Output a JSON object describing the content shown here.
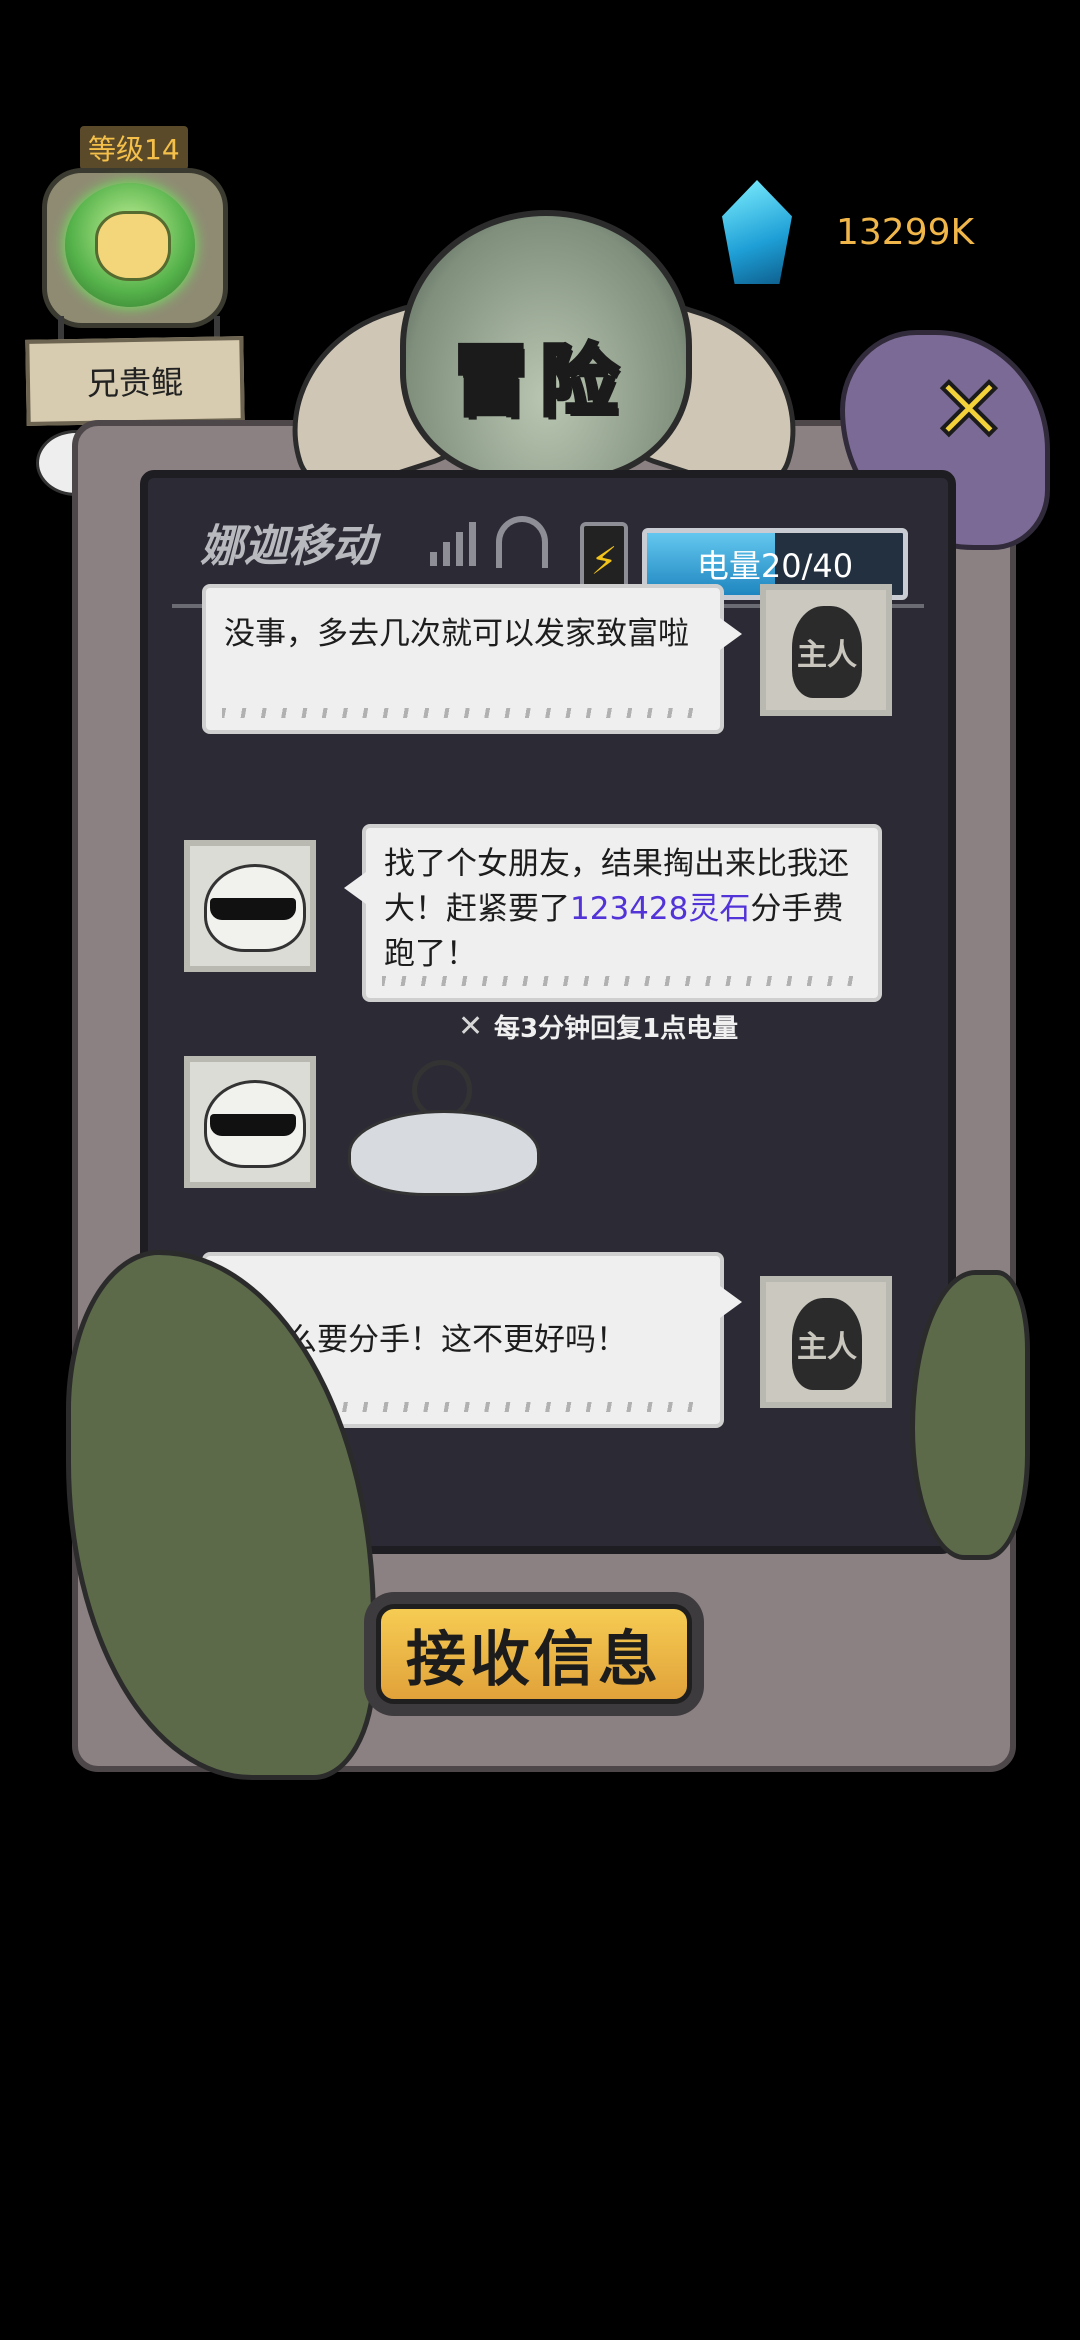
{
  "player": {
    "level": "等级14",
    "name": "兄贵鲲"
  },
  "alert": "!",
  "currency": {
    "icon": "spirit-stone-gem-icon",
    "value": "13299K",
    "color": "#f0b64a"
  },
  "title": "冒险",
  "close_label": "✕",
  "phone": {
    "carrier": "娜迦移动",
    "battery_symbol": "⚡",
    "energy": {
      "label": "电量20/40",
      "current": 20,
      "max": 40
    }
  },
  "messages": [
    {
      "sender": "owner",
      "avatar_label": "主人",
      "text": "没事，多去几次就可以发家致富啦"
    },
    {
      "sender": "friend",
      "text_before": "找了个女朋友，结果掏出来比我还大！赶紧要了",
      "highlight": "123428灵石",
      "text_after": "分手费跑了！"
    },
    {
      "sender": "friend",
      "sticker": "dizzy-fish-sticker"
    },
    {
      "sender": "owner",
      "avatar_label": "主人",
      "text": "为什么要分手！这不更好吗！"
    }
  ],
  "recharge_note": "每3分钟回复1点电量",
  "receive_button": "接收信息",
  "colors": {
    "accent": "#f6c623",
    "highlight": "#5233d8",
    "energy": "#1f86c0"
  }
}
